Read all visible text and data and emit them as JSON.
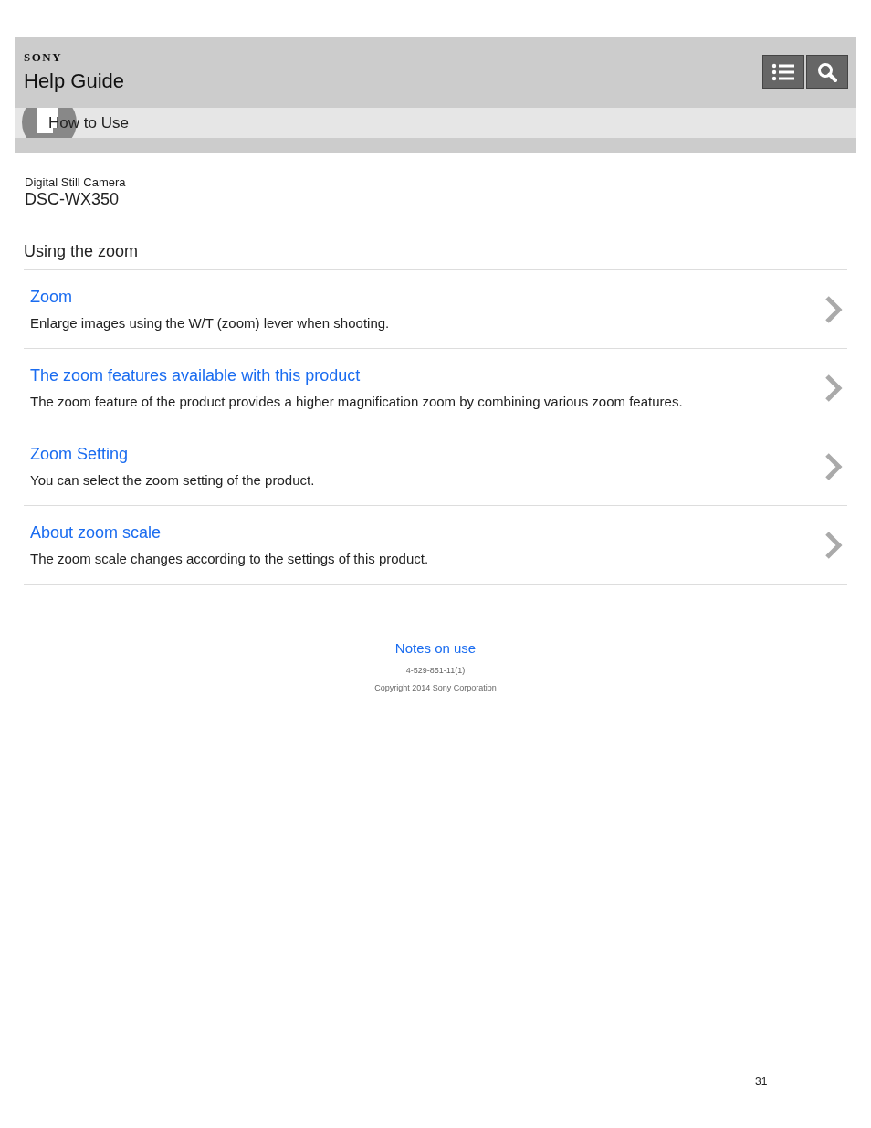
{
  "header": {
    "brand": "SONY",
    "title": "Help Guide",
    "breadcrumb": "How to Use"
  },
  "product": {
    "category": "Digital Still Camera",
    "model": "DSC-WX350"
  },
  "section_title": "Using the zoom",
  "topics": [
    {
      "title": "Zoom",
      "description": "Enlarge images using the W/T (zoom) lever when shooting."
    },
    {
      "title": "The zoom features available with this product",
      "description": "The zoom feature of the product provides a higher magnification zoom by combining various zoom features."
    },
    {
      "title": "Zoom Setting",
      "description": "You can select the zoom setting of the product."
    },
    {
      "title": "About zoom scale",
      "description": "The zoom scale changes according to the settings of this product."
    }
  ],
  "footer": {
    "link": "Notes on use",
    "code": "4-529-851-11(1)",
    "copyright": "Copyright 2014 Sony Corporation"
  },
  "page_number": "31"
}
